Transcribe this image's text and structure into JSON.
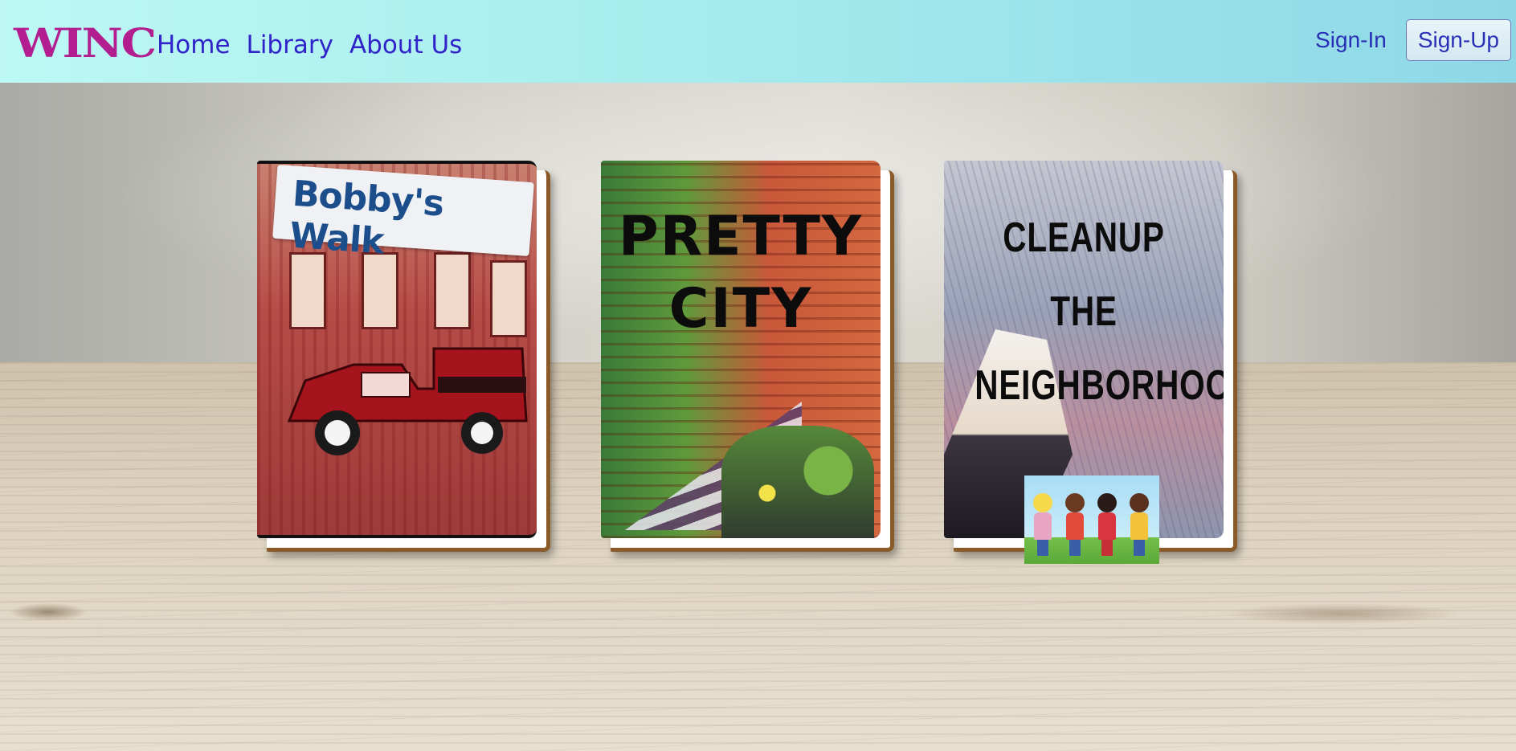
{
  "navbar": {
    "brand": "WINC",
    "links": [
      "Home",
      "Library",
      "About Us"
    ],
    "signin_label": "Sign-In",
    "signup_label": "Sign-Up"
  },
  "books": [
    {
      "title_line1": "Bobby's Walk"
    },
    {
      "title_line1": "PRETTY",
      "title_line2": "CITY"
    },
    {
      "title_line1": "CLEANUP THE",
      "title_line2": "NEIGHBORHOOD!"
    }
  ],
  "colors": {
    "brand": "#b21e8f",
    "nav_link": "#2f23c9",
    "navbar_bg_start": "#bdf8f4",
    "navbar_bg_end": "#8ed8e6",
    "book_spine": "#8a5a28"
  },
  "icons": {
    "kids_illustration": "children-holding-hands-image"
  }
}
